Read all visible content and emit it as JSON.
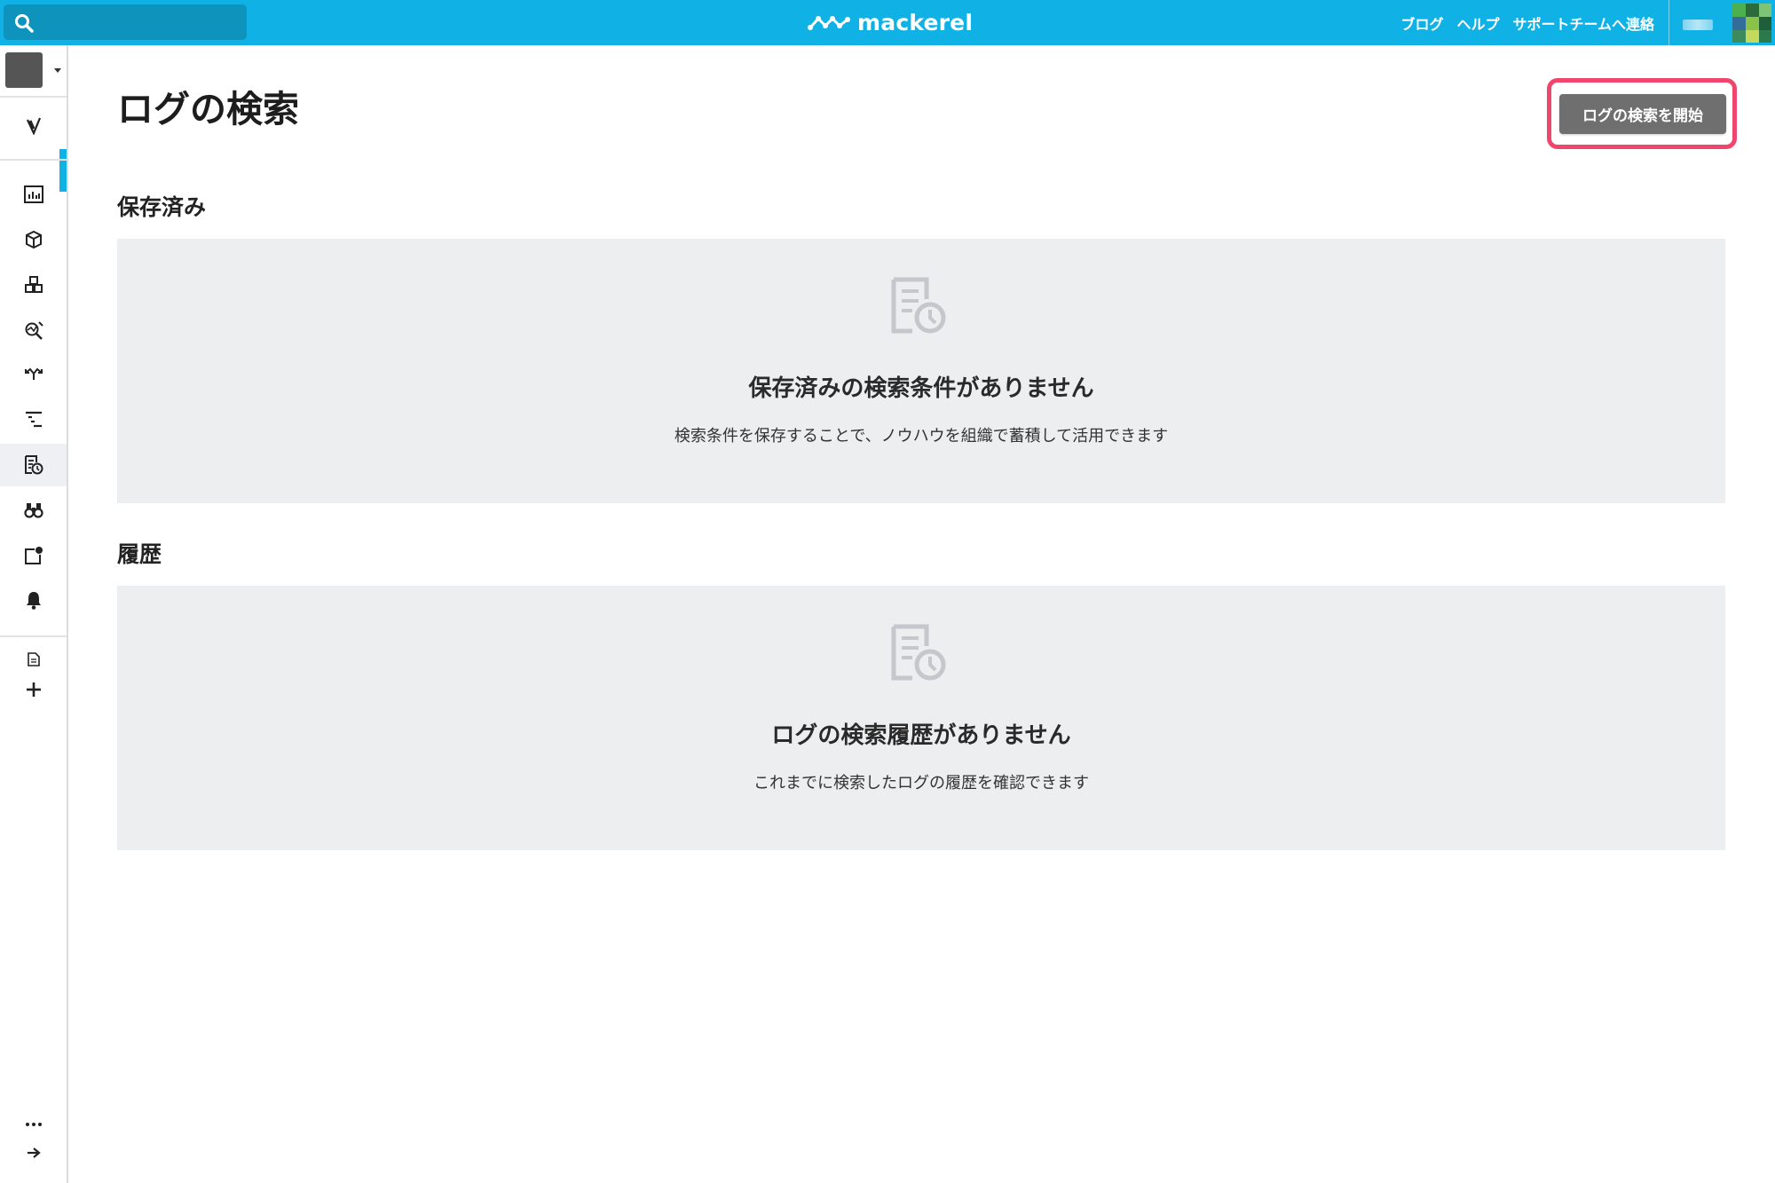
{
  "header": {
    "brand": "mackerel",
    "links": [
      "ブログ",
      "ヘルプ",
      "サポートチームへ連絡"
    ],
    "colors": {
      "bar": "#10b2e5",
      "search": "#0e93bd"
    }
  },
  "sidebar": {
    "items": [
      {
        "name": "checkmark-shield-icon",
        "active": false
      },
      {
        "name": "dashboard-chart-icon",
        "active": false
      },
      {
        "name": "cube-hosts-icon",
        "active": false
      },
      {
        "name": "services-cubes-icon",
        "active": false
      },
      {
        "name": "trace-search-icon",
        "active": false
      },
      {
        "name": "connectivity-arrows-icon",
        "active": false
      },
      {
        "name": "timeline-tree-icon",
        "active": false
      },
      {
        "name": "log-search-icon",
        "active": true
      },
      {
        "name": "binoculars-icon",
        "active": false
      },
      {
        "name": "alert-note-icon",
        "active": false
      },
      {
        "name": "bell-icon",
        "active": false
      },
      {
        "name": "document-icon",
        "active": false
      },
      {
        "name": "plus-icon",
        "active": false
      },
      {
        "name": "more-dots-icon",
        "active": false
      },
      {
        "name": "arrow-right-icon",
        "active": false
      }
    ]
  },
  "main": {
    "title": "ログの検索",
    "start_button": "ログの検索を開始",
    "saved": {
      "title": "保存済み",
      "empty_heading": "保存済みの検索条件がありません",
      "empty_description": "検索条件を保存することで、ノウハウを組織で蓄積して活用できます"
    },
    "history": {
      "title": "履歴",
      "empty_heading": "ログの検索履歴がありません",
      "empty_description": "これまでに検索したログの履歴を確認できます"
    },
    "highlight_color": "#f0466e"
  }
}
